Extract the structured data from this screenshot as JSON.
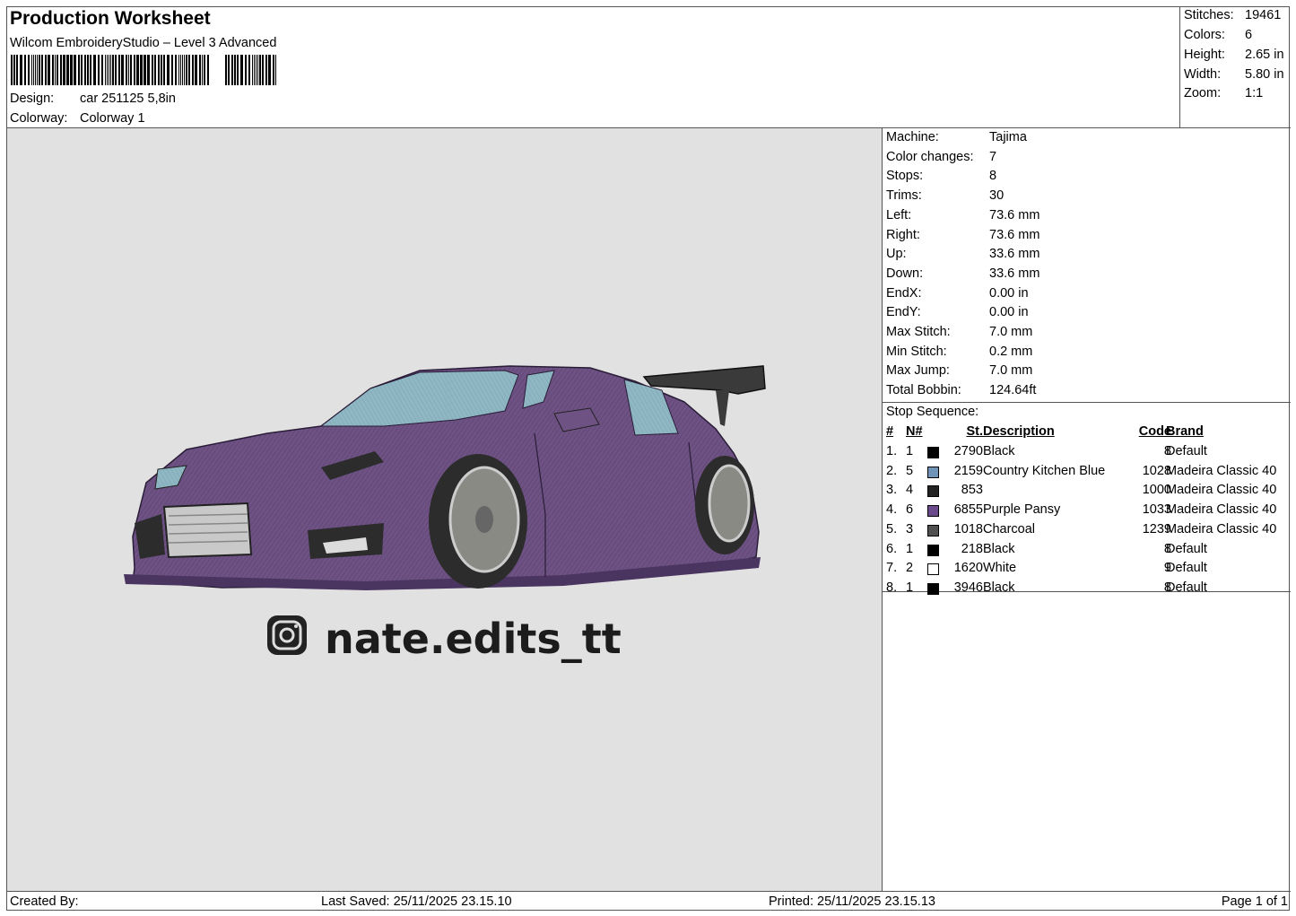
{
  "header": {
    "title": "Production Worksheet",
    "software": "Wilcom EmbroideryStudio – Level 3 Advanced",
    "design_label": "Design:",
    "design_value": "car 251125 5,8in",
    "colorway_label": "Colorway:",
    "colorway_value": "Colorway 1"
  },
  "summary": [
    {
      "label": "Stitches:",
      "value": "19461"
    },
    {
      "label": "Colors:",
      "value": "6"
    },
    {
      "label": "Height:",
      "value": "2.65 in"
    },
    {
      "label": "Width:",
      "value": "5.80 in"
    },
    {
      "label": "Zoom:",
      "value": "1:1"
    }
  ],
  "design_area": {
    "text": "nate.edits_tt",
    "icon": "instagram-icon",
    "colors": {
      "background": "#e1e1e1",
      "body": "#6e5284",
      "glass": "#8fb7c3",
      "dark": "#2c2c2c"
    }
  },
  "machine_info": [
    {
      "label": "Machine:",
      "value": "Tajima"
    },
    {
      "label": "Color changes:",
      "value": "7"
    },
    {
      "label": "Stops:",
      "value": "8"
    },
    {
      "label": "Trims:",
      "value": "30"
    },
    {
      "label": "Left:",
      "value": "73.6 mm"
    },
    {
      "label": "Right:",
      "value": "73.6 mm"
    },
    {
      "label": "Up:",
      "value": "33.6 mm"
    },
    {
      "label": "Down:",
      "value": "33.6 mm"
    },
    {
      "label": "EndX:",
      "value": "0.00 in"
    },
    {
      "label": "EndY:",
      "value": "0.00 in"
    },
    {
      "label": "Max Stitch:",
      "value": "7.0 mm"
    },
    {
      "label": "Min Stitch:",
      "value": "0.2 mm"
    },
    {
      "label": "Max Jump:",
      "value": "7.0 mm"
    },
    {
      "label": "Total Bobbin:",
      "value": "124.64ft"
    }
  ],
  "stop_sequence": {
    "heading": "Stop Sequence:",
    "columns": {
      "num": "#",
      "n": "N#",
      "st": "St.",
      "desc": "Description",
      "code": "Code",
      "brand": "Brand"
    },
    "rows": [
      {
        "num": "1.",
        "n": "1",
        "color": "#000000",
        "st": "2790",
        "desc": "Black",
        "code": "8",
        "brand": "Default"
      },
      {
        "num": "2.",
        "n": "5",
        "color": "#6f94b8",
        "st": "2159",
        "desc": "Country Kitchen Blue",
        "code": "1028",
        "brand": "Madeira Classic 40"
      },
      {
        "num": "3.",
        "n": "4",
        "color": "#222222",
        "st": "853",
        "desc": "",
        "code": "1000",
        "brand": "Madeira Classic 40"
      },
      {
        "num": "4.",
        "n": "6",
        "color": "#6b4a8c",
        "st": "6855",
        "desc": "Purple Pansy",
        "code": "1033",
        "brand": "Madeira Classic 40"
      },
      {
        "num": "5.",
        "n": "3",
        "color": "#505050",
        "st": "1018",
        "desc": "Charcoal",
        "code": "1239",
        "brand": "Madeira Classic 40"
      },
      {
        "num": "6.",
        "n": "1",
        "color": "#000000",
        "st": "218",
        "desc": "Black",
        "code": "8",
        "brand": "Default"
      },
      {
        "num": "7.",
        "n": "2",
        "color": "#ffffff",
        "st": "1620",
        "desc": "White",
        "code": "9",
        "brand": "Default"
      },
      {
        "num": "8.",
        "n": "1",
        "color": "#000000",
        "st": "3946",
        "desc": "Black",
        "code": "8",
        "brand": "Default"
      }
    ]
  },
  "footer": {
    "created_by": "Created By:",
    "last_saved": "Last Saved: 25/11/2025 23.15.10",
    "printed": "Printed: 25/11/2025 23.15.13",
    "page": "Page 1 of 1"
  }
}
